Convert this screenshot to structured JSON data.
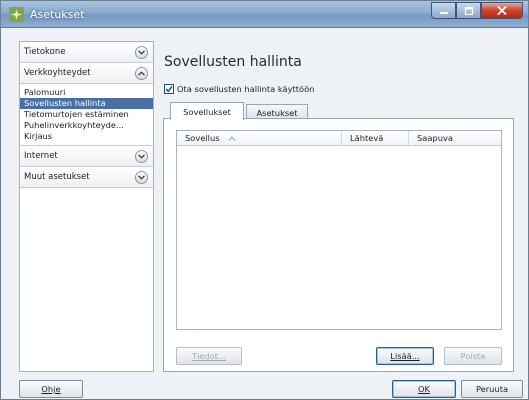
{
  "window": {
    "title": "Asetukset"
  },
  "sidebar": {
    "sections": [
      {
        "label": "Tietokone",
        "expanded": false
      },
      {
        "label": "Verkkoyhteydet",
        "expanded": true,
        "items": [
          "Palomuuri",
          "Sovellusten hallinta",
          "Tietomurtojen estäminen",
          "Puhelinverkkoyhteyde...",
          "Kirjaus"
        ],
        "selected_index": 1
      },
      {
        "label": "Internet",
        "expanded": false
      },
      {
        "label": "Muut asetukset",
        "expanded": false
      }
    ]
  },
  "main": {
    "title": "Sovellusten hallinta",
    "enable_checkbox": {
      "label": "Ota sovellusten hallinta käyttöön",
      "checked": true
    },
    "tabs": [
      {
        "label": "Sovellukset",
        "active": true
      },
      {
        "label": "Asetukset",
        "active": false
      }
    ],
    "table": {
      "columns": [
        "Sovellus",
        "Lähtevä",
        "Saapuva"
      ],
      "rows": []
    },
    "buttons": {
      "details": "Tiedot...",
      "add": "Lisää...",
      "remove": "Poista"
    }
  },
  "footer": {
    "help": "Ohje",
    "ok": "OK",
    "cancel": "Peruuta"
  },
  "colors": {
    "selection": "#4a6fa5",
    "titlebar": "#8aabd0",
    "close_button": "#c8452f"
  }
}
